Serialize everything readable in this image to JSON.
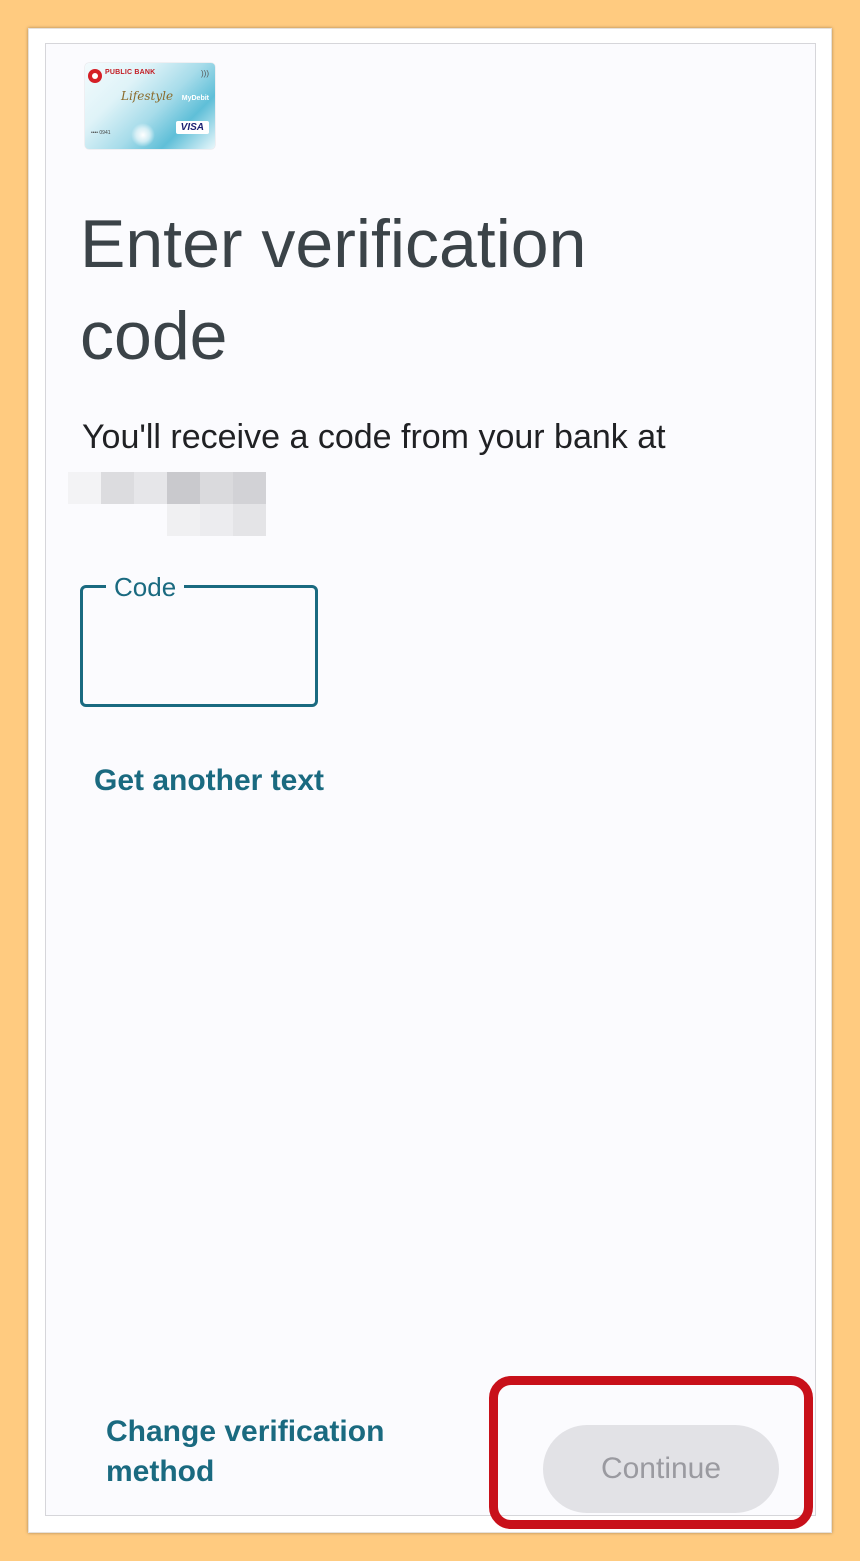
{
  "card": {
    "bank_name": "PUBLIC BANK",
    "product_name": "Lifestyle",
    "network_label": "MyDebit",
    "card_number_tail": "•••• 0941",
    "brand": "VISA"
  },
  "page": {
    "title": "Enter verification code",
    "subtitle": "You'll receive a code from your bank at"
  },
  "code_field": {
    "label": "Code",
    "value": ""
  },
  "links": {
    "get_another_text": "Get another text",
    "change_method": "Change verification method"
  },
  "actions": {
    "continue_label": "Continue",
    "continue_enabled": false
  },
  "colors": {
    "accent": "#1a6a80",
    "highlight": "#c8101a",
    "background_outer": "#ffcb80",
    "button_disabled_bg": "#e2e2e6",
    "button_disabled_text": "#9a9aa0"
  }
}
